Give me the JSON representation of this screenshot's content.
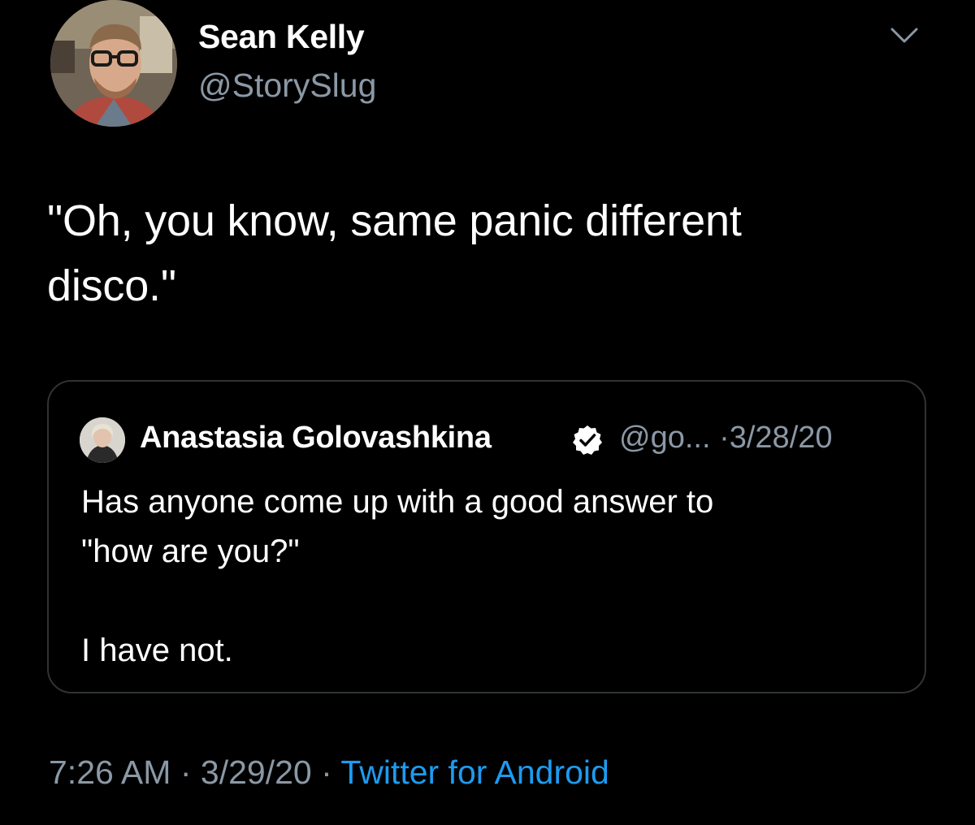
{
  "tweet": {
    "author": {
      "display_name": "Sean Kelly",
      "handle": "@StorySlug",
      "avatar_icon": "profile-photo"
    },
    "menu_icon": "chevron-down-icon",
    "text_line1": "\"Oh, you know, same panic different",
    "text_line2": "disco.\"",
    "time": "7:26 AM",
    "separator": "·",
    "date": "3/29/20",
    "source": "Twitter for Android"
  },
  "quoted": {
    "display_name": "Anastasia Golovashkina",
    "verified_icon": "verified-badge-icon",
    "handle": "@go...",
    "separator": "·",
    "date": "3/28/20",
    "line1": "Has anyone come up with a good answer to",
    "line2": "\"how are you?\"",
    "line3": "I have not."
  },
  "colors": {
    "background": "#000000",
    "text": "#ffffff",
    "secondary_text": "#8b98a5",
    "link": "#1d9bf0",
    "border": "#2f3336"
  }
}
